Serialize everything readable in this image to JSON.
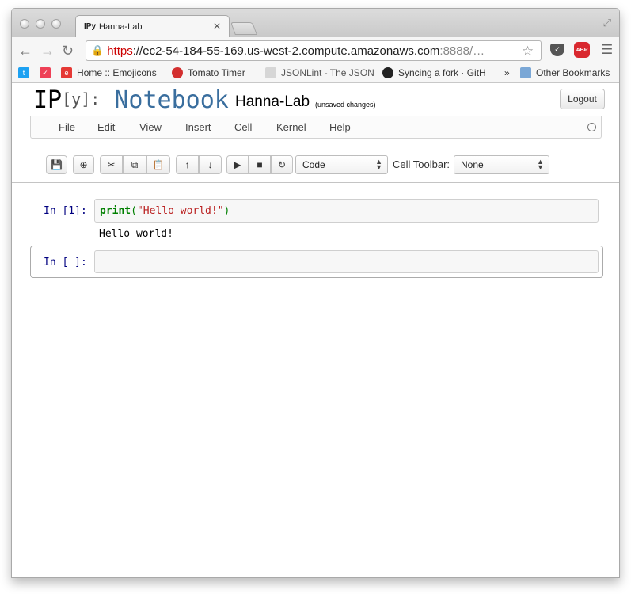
{
  "browser": {
    "tab_favicon": "IPy",
    "tab_title": "Hanna-Lab",
    "url_scheme": "https",
    "url_rest": "://ec2-54-184-55-169.us-west-2.compute.amazonaws.com",
    "url_port": ":8888/…",
    "bookmarks": [
      {
        "label": "",
        "icon": "twitter-icon",
        "color": "#1da1f2"
      },
      {
        "label": "",
        "icon": "pocket-icon",
        "color": "#ee4056"
      },
      {
        "label": "Home :: Emojicons",
        "icon": "emojicons-icon",
        "color": "#e53935"
      },
      {
        "label": "Tomato Timer",
        "icon": "tomato-icon",
        "color": "#d32f2f"
      },
      {
        "label": "JSONLint - The JSON",
        "icon": "jsonlint-icon",
        "color": "#cccccc"
      },
      {
        "label": "Syncing a fork · GitH",
        "icon": "github-icon",
        "color": "#222222"
      },
      {
        "label": "»",
        "icon": "",
        "color": ""
      },
      {
        "label": "Other Bookmarks",
        "icon": "folder-icon",
        "color": "#7aa7d6"
      }
    ]
  },
  "notebook": {
    "logo_ip": "IP",
    "logo_y": "[y]:",
    "logo_notebook": "Notebook",
    "name": "Hanna-Lab",
    "save_status": "(unsaved changes)",
    "logout_label": "Logout",
    "menu": [
      "File",
      "Edit",
      "View",
      "Insert",
      "Cell",
      "Kernel",
      "Help"
    ],
    "cell_type": "Code",
    "cell_toolbar_label": "Cell Toolbar:",
    "cell_toolbar_value": "None",
    "cells": [
      {
        "prompt": "In [1]:",
        "code_keyword": "print",
        "code_open": "(",
        "code_string": "\"Hello world!\"",
        "code_close": ")",
        "output": "Hello world!"
      },
      {
        "prompt": "In [ ]:",
        "code": ""
      }
    ]
  },
  "colors": {
    "accent": "#3a6e9e",
    "prompt": "#000080",
    "keyword": "#008000",
    "string": "#ba2121"
  }
}
